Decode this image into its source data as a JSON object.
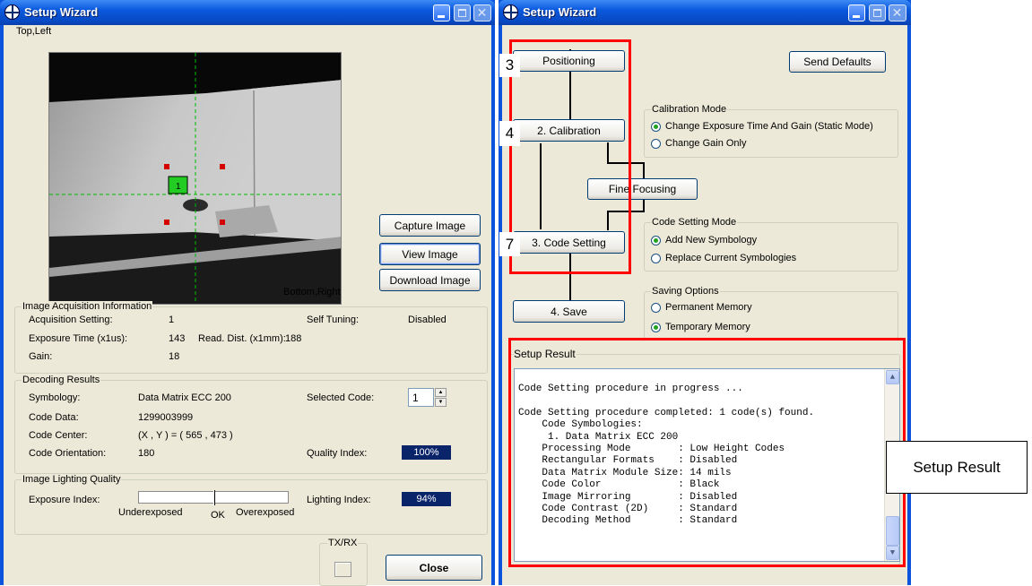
{
  "left_window": {
    "title": "Setup Wizard",
    "corner_top_left": "Top,Left",
    "corner_bottom_right": "Bottom,Right",
    "buttons": {
      "capture": "Capture Image",
      "view": "View Image",
      "download": "Download Image",
      "close": "Close"
    },
    "acquisition": {
      "group_label": "Image Acquisition Information",
      "acquisition_setting_label": "Acquisition Setting:",
      "acquisition_setting_value": "1",
      "self_tuning_label": "Self Tuning:",
      "self_tuning_value": "Disabled",
      "exposure_label": "Exposure Time (x1us):",
      "exposure_value": "143",
      "read_dist_label": "Read. Dist. (x1mm):",
      "read_dist_value": "188",
      "gain_label": "Gain:",
      "gain_value": "18"
    },
    "decoding": {
      "group_label": "Decoding Results",
      "symbology_label": "Symbology:",
      "symbology_value": "Data Matrix ECC 200",
      "selected_code_label": "Selected Code:",
      "selected_code_value": "1",
      "code_data_label": "Code Data:",
      "code_data_value": "1299003999",
      "code_center_label": "Code Center:",
      "code_center_value": "(X , Y ) = ( 565 , 473 )",
      "orientation_label": "Code Orientation:",
      "orientation_value": "180",
      "quality_label": "Quality Index:",
      "quality_value": "100%"
    },
    "lighting": {
      "group_label": "Image Lighting Quality",
      "exposure_index_label": "Exposure Index:",
      "underexposed": "Underexposed",
      "ok": "OK",
      "overexposed": "Overexposed",
      "exposure_index_level": 0.5,
      "lighting_index_label": "Lighting Index:",
      "lighting_index_value": "94%"
    },
    "txrx_label": "TX/RX",
    "target_marker_label": "1"
  },
  "right_window": {
    "title": "Setup Wizard",
    "buttons": {
      "positioning": "Positioning",
      "calibration": "2. Calibration",
      "fine_focusing": "Fine Focusing",
      "code_setting": "3. Code Setting",
      "save": "4. Save",
      "send_defaults": "Send Defaults"
    },
    "callouts": {
      "positioning": "3",
      "calibration": "4",
      "code_setting": "7",
      "setup_result": "Setup Result"
    },
    "calibration_mode": {
      "group_label": "Calibration Mode",
      "options": [
        "Change Exposure Time And Gain (Static Mode)",
        "Change Gain Only"
      ],
      "selected": 0
    },
    "code_setting_mode": {
      "group_label": "Code Setting Mode",
      "options": [
        "Add New Symbology",
        "Replace Current Symbologies"
      ],
      "selected": 0
    },
    "saving_options": {
      "group_label": "Saving Options",
      "options": [
        "Permanent Memory",
        "Temporary Memory"
      ],
      "selected": 1
    },
    "setup_result": {
      "group_label": "Setup Result",
      "lines": [
        "Code Setting procedure in progress ...",
        "",
        "Code Setting procedure completed: 1 code(s) found.",
        "    Code Symbologies:",
        "     1. Data Matrix ECC 200",
        "    Processing Mode        : Low Height Codes",
        "    Rectangular Formats    : Disabled",
        "    Data Matrix Module Size: 14 mils",
        "    Code Color             : Black",
        "    Image Mirroring        : Disabled",
        "    Code Contrast (2D)     : Standard",
        "    Decoding Method        : Standard"
      ]
    }
  },
  "colors": {
    "titlebar": "#0a58dd",
    "face": "#ece9d8",
    "meter": "#0a246a",
    "annotation": "#ff0000",
    "marker": "#22cc22"
  }
}
